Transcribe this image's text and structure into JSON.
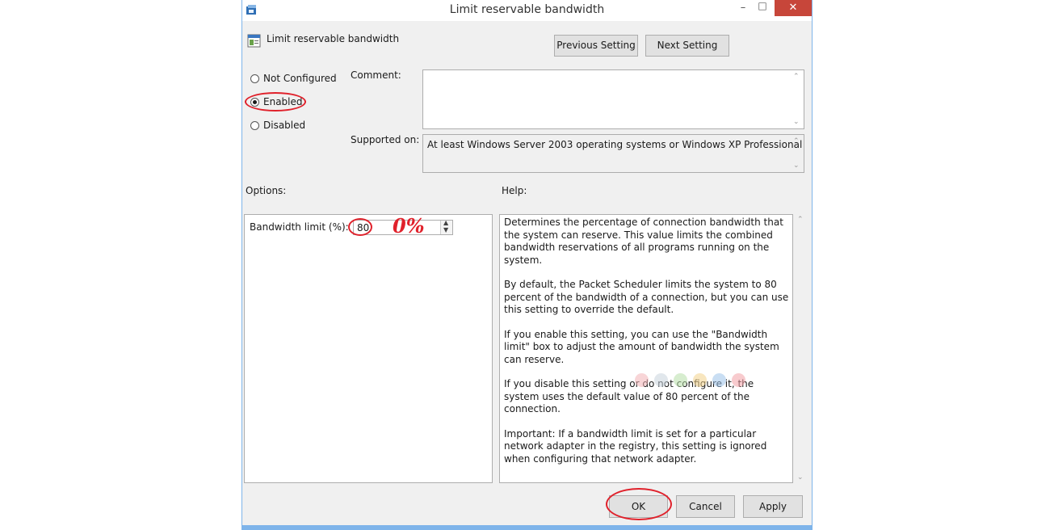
{
  "window": {
    "title": "Limit reservable bandwidth",
    "close_glyph": "✕",
    "min_glyph": "–",
    "max_glyph": "□"
  },
  "header": {
    "policy_name": "Limit reservable bandwidth",
    "policy_icon": "policy-settings-icon",
    "previous_label": "Previous Setting",
    "next_label": "Next Setting"
  },
  "state": {
    "not_configured": "Not Configured",
    "enabled": "Enabled",
    "disabled": "Disabled",
    "selected": "enabled"
  },
  "comment": {
    "label": "Comment:",
    "value": ""
  },
  "supported": {
    "label": "Supported on:",
    "value": "At least Windows Server 2003 operating systems or Windows XP Professional"
  },
  "options": {
    "label": "Options:",
    "bandwidth_label": "Bandwidth limit (%):",
    "bandwidth_value": "80",
    "annotation": "0%"
  },
  "help": {
    "label": "Help:",
    "paragraphs": [
      "Determines the percentage of connection bandwidth that the system can reserve. This value limits the combined bandwidth reservations of all programs running on the system.",
      "By default, the Packet Scheduler limits the system to 80 percent of the bandwidth of a connection, but you can use this setting to override the default.",
      "If you enable this setting, you can use the \"Bandwidth limit\" box to adjust the amount of bandwidth the system can reserve.",
      "If you disable this setting or do not configure it, the system uses the default value of 80 percent of the connection.",
      "Important: If a bandwidth limit is set for a particular network adapter in the registry, this setting is ignored when configuring that network adapter."
    ]
  },
  "footer": {
    "ok_label": "OK",
    "cancel_label": "Cancel",
    "apply_label": "Apply"
  },
  "colors": {
    "annotation_red": "#e0212b",
    "close_red": "#c7463a",
    "frame_blue": "#7eb4ea"
  }
}
